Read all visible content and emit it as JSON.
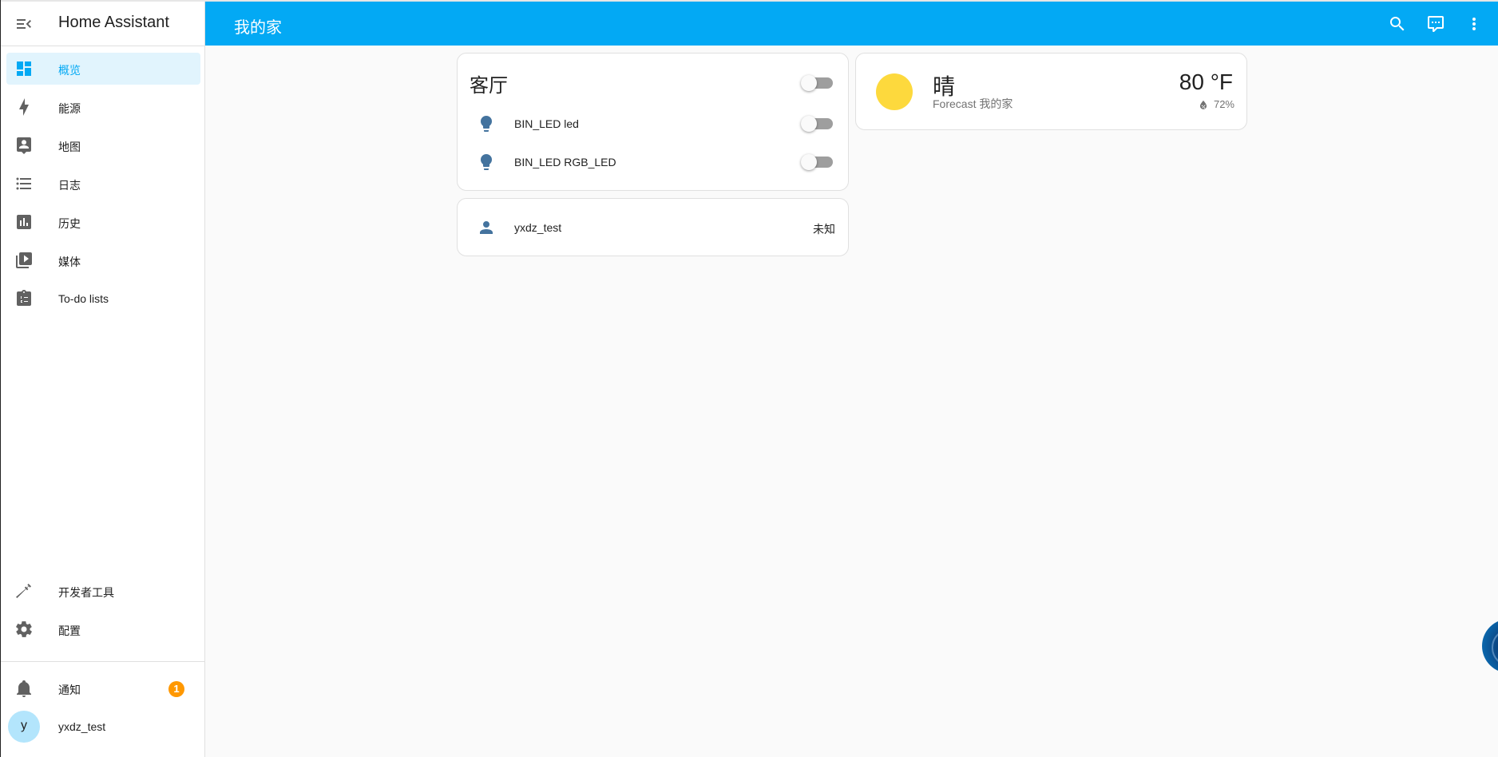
{
  "sidebar": {
    "title": "Home Assistant",
    "items": [
      {
        "label": "概览",
        "icon": "view-dashboard-icon",
        "active": true
      },
      {
        "label": "能源",
        "icon": "lightning-bolt-icon"
      },
      {
        "label": "地图",
        "icon": "map-account-icon"
      },
      {
        "label": "日志",
        "icon": "format-list-bulleted-icon"
      },
      {
        "label": "历史",
        "icon": "chart-box-icon"
      },
      {
        "label": "媒体",
        "icon": "play-box-multiple-icon"
      },
      {
        "label": "To-do lists",
        "icon": "clipboard-list-icon"
      }
    ],
    "bottom_items": [
      {
        "label": "开发者工具",
        "icon": "hammer-icon"
      },
      {
        "label": "配置",
        "icon": "cog-icon"
      }
    ],
    "notifications": {
      "label": "通知",
      "count": "1"
    },
    "user": {
      "name": "yxdz_test",
      "initial": "y"
    }
  },
  "header": {
    "title": "我的家",
    "actions": [
      "search-icon",
      "assist-icon",
      "more-vert-icon"
    ]
  },
  "cards": {
    "living_room": {
      "title": "客厅",
      "master_toggle": "off",
      "entities": [
        {
          "name": "BIN_LED led",
          "icon": "lightbulb-icon",
          "state": "off"
        },
        {
          "name": "BIN_LED RGB_LED",
          "icon": "lightbulb-icon",
          "state": "off"
        }
      ]
    },
    "person": {
      "name": "yxdz_test",
      "state": "未知"
    },
    "weather": {
      "condition": "晴",
      "name": "Forecast 我的家",
      "temperature": "80 °F",
      "humidity": "72%",
      "sun_color": "#fdd93d"
    }
  },
  "colors": {
    "primary": "#03a9f4",
    "icon_entity": "#44739e",
    "badge": "#ff9800"
  }
}
